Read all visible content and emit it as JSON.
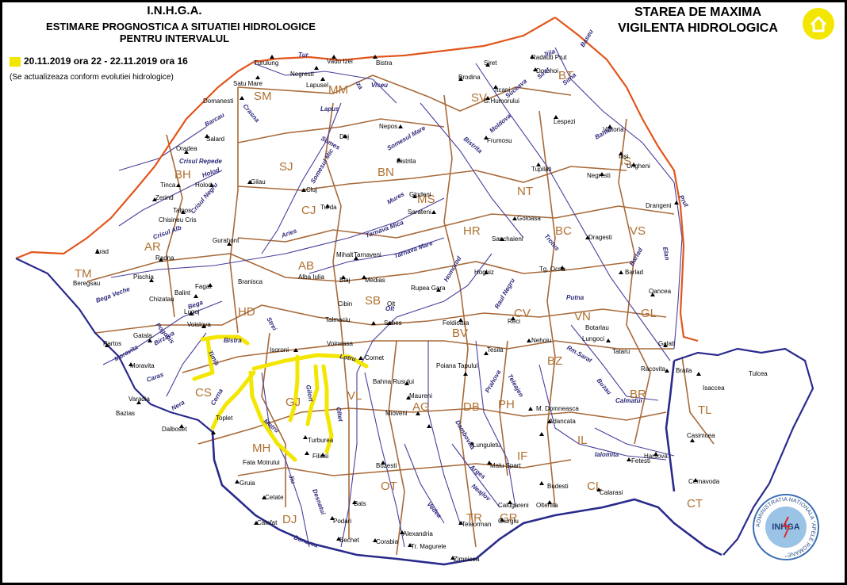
{
  "header": {
    "org": "I.N.H.G.A.",
    "line2": "ESTIMARE PROGNOSTICA A SITUATIEI HIDROLOGICE",
    "line3": "PENTRU INTERVALUL",
    "interval": "20.11.2019 ora 22  - 22.11.2019 ora 16",
    "note": "(Se actualizeaza conform evolutiei hidrologice)",
    "status_line1": "STAREA DE MAXIMA",
    "status_line2": "VIGILENTA HIDROLOGICA"
  },
  "colors": {
    "warning_yellow": "#f3e600",
    "border_orange": "#e2561b",
    "border_navy": "#2a2a8c",
    "county_brown": "#a86a3a",
    "river_purple": "#4a3f9a"
  },
  "icons": {
    "home": "home-icon",
    "logo": "inhga-logo"
  },
  "logo": {
    "ring": "ADMINISTRATIA NATIONALA \"APELE ROMANE\"",
    "name": "INHGA"
  },
  "counties": [
    "SM",
    "MM",
    "BT",
    "SV",
    "SJ",
    "BN",
    "BH",
    "CJ",
    "MS",
    "NT",
    "IS",
    "HR",
    "BC",
    "VS",
    "AR",
    "AB",
    "TM",
    "HD",
    "SB",
    "BV",
    "CV",
    "VN",
    "GL",
    "CS",
    "GJ",
    "VL",
    "AG",
    "DB",
    "PH",
    "BZ",
    "BR",
    "TL",
    "MH",
    "OT",
    "DJ",
    "TR",
    "GR",
    "IF",
    "CL",
    "IL",
    "CT"
  ],
  "stations": [
    "Turulung",
    "Vadu Izei",
    "Bistra",
    "Negresti",
    "Satu Mare",
    "Lapusel",
    "Radauti Prut",
    "Siret",
    "Dorohoi",
    "Brodina",
    "Itcani",
    "Domanesti",
    "G.Humorului",
    "Lespezi",
    "Victoria",
    "Nepos",
    "Dej",
    "Salard",
    "Oradea",
    "Frumosu",
    "Iasi",
    "Ungheni",
    "Bistrita",
    "Tupilati",
    "Negresti",
    "Cluj",
    "Tinca",
    "Holod",
    "Gilau",
    "Zerind",
    "Baciu",
    "Turda",
    "Glodeni",
    "Talpos",
    "Chisineu Cris",
    "Sarateni",
    "Goloasa",
    "Dragesti",
    "Drangeni",
    "Sanchaieni",
    "Gurahont",
    "Arad",
    "Radna",
    "Mihalt",
    "Tarnaveni",
    "Tg. Ocna",
    "Barlad",
    "Hoghiz",
    "Beregsau",
    "Pischia",
    "Fagat",
    "Branisca",
    "Alba Iulia",
    "Blaj",
    "Medias",
    "Rupea Gara",
    "Balint",
    "Chizatau",
    "Lugoj",
    "Oancea",
    "Cibin",
    "Olt",
    "Botarlau",
    "Feldioara",
    "Reci",
    "Tecuci",
    "Talmaciu",
    "Sebes",
    "Nehoiu",
    "Lungoci",
    "Tataru",
    "Gatala",
    "Voislova",
    "Partos",
    "Isoroni",
    "Voineasa",
    "Galati",
    "Tesila",
    "Racovita",
    "Braila",
    "Tulcea",
    "Moravita",
    "Cornet",
    "Bahna Rusului",
    "Poiana Tapului",
    "Isaccea",
    "Varadia",
    "Maureni",
    "Mioveni",
    "Bazias",
    "Toplet",
    "M. Domneasca",
    "Adancata",
    "Dalboset",
    "Malu cu Flori",
    "Coseneni",
    "Harsova",
    "Turburea",
    "Lunguletu",
    "Casimcea",
    "Fata Motrului",
    "Filiasi",
    "Buzesti",
    "Fetesti",
    "Malu Spart",
    "Cernavoda",
    "Gruia",
    "Budesti",
    "Calugareni",
    "Oltenita",
    "Calarasi",
    "Cetate",
    "Bals",
    "Giurgiu",
    "Calafat",
    "Podari",
    "Alexandria",
    "Teleorman",
    "Bechet",
    "Corabia",
    "Tr. Magurele",
    "Zimnicea"
  ],
  "rivers": [
    "Tur",
    "Iza",
    "Viseu",
    "Siret",
    "Suceava",
    "Jijia",
    "Baseu",
    "Sitna",
    "Crasna",
    "Lapus",
    "Somes",
    "Barcau",
    "Bahlui",
    "Moldova",
    "Bistrita",
    "Crisul Repede",
    "Somesul Mare",
    "Somesul Mic",
    "Holod",
    "Crisul Negru",
    "Prut",
    "Mures",
    "Aries",
    "Crisul Alb",
    "Tarnava Mica",
    "Tarnava Mare",
    "Homorod",
    "Trotus",
    "Elan",
    "Barlad",
    "Bega Veche",
    "Bega",
    "Olt",
    "Raul Negru",
    "Putna",
    "Strei",
    "Pogonis",
    "Birzava",
    "Timis",
    "Rm.Sarat",
    "Moravita",
    "Caras",
    "Bistra",
    "Lotru",
    "Buzau",
    "Cerna",
    "Nera",
    "Motru",
    "Gilort",
    "Oltet",
    "Prahova",
    "Teleajen",
    "Calmatui",
    "Jiu",
    "Dambovita",
    "Ialomita",
    "Arges",
    "Vedea",
    "Desnatui",
    "Neajlov",
    "Dunarea"
  ]
}
